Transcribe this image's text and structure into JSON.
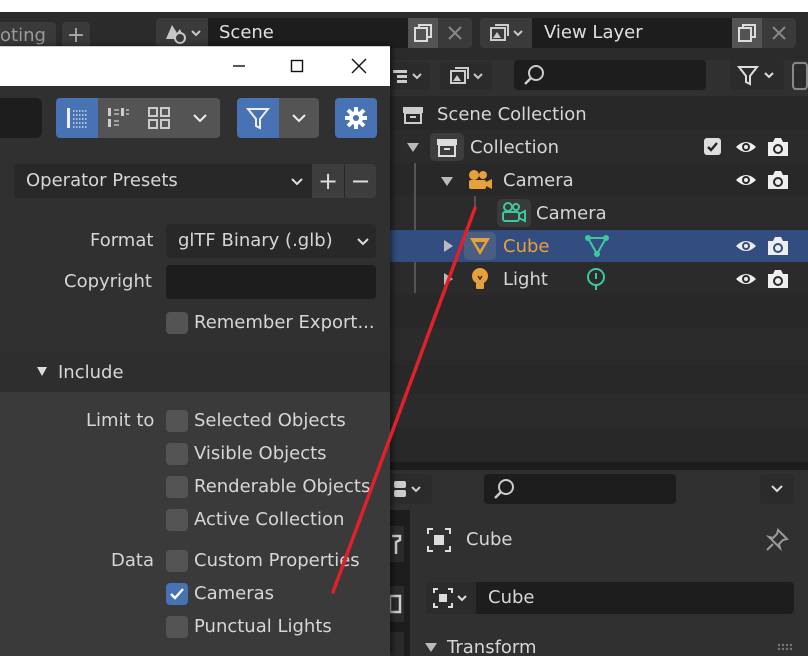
{
  "titlebar": {
    "workspace_tab_partial": "oting",
    "add_tab_glyph": "+",
    "scene_value": "Scene",
    "view_layer_value": "View Layer"
  },
  "dialog": {
    "window_controls": {
      "minimize": "—",
      "maximize": "☐",
      "close": "✕"
    },
    "operator_presets_label": "Operator Presets",
    "preset_add": "+",
    "preset_remove": "−",
    "format_label": "Format",
    "format_value": "glTF Binary (.glb)",
    "copyright_label": "Copyright",
    "copyright_value": "",
    "remember_export_label": "Remember Export...",
    "include_section": "Include",
    "limit_to_label": "Limit to",
    "limit_options": [
      {
        "label": "Selected Objects",
        "checked": false
      },
      {
        "label": "Visible Objects",
        "checked": false
      },
      {
        "label": "Renderable Objects",
        "checked": false
      },
      {
        "label": "Active Collection",
        "checked": false
      }
    ],
    "data_label": "Data",
    "data_options": [
      {
        "label": "Custom Properties",
        "checked": false
      },
      {
        "label": "Cameras",
        "checked": true
      },
      {
        "label": "Punctual Lights",
        "checked": false
      }
    ]
  },
  "outliner": {
    "scene_collection": "Scene Collection",
    "collection": "Collection",
    "camera_object": "Camera",
    "camera_data": "Camera",
    "cube": "Cube",
    "light": "Light"
  },
  "properties": {
    "header_object": "Cube",
    "object_name_value": "Cube",
    "transform_section": "Transform"
  },
  "colors": {
    "selected_row": "#334d80",
    "checkbox_on": "#4772b3",
    "cube_text": "#e8a03a",
    "annotation_line": "#e0202a"
  }
}
